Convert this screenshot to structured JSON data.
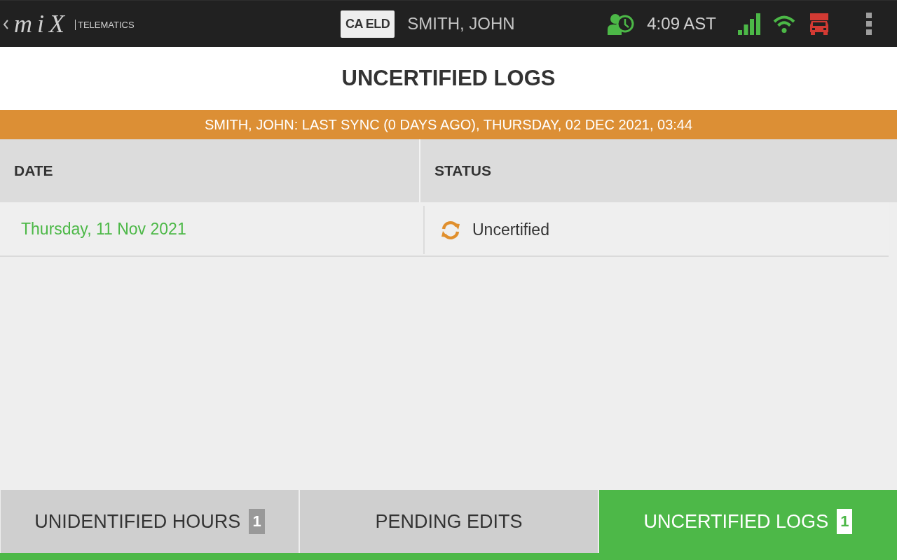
{
  "top_bar": {
    "logo": {
      "wordmark": "miX",
      "tagline": "TELEMATICS"
    },
    "mode_badge": "CA ELD",
    "driver_name": "SMITH, JOHN",
    "time": "4:09 AST"
  },
  "title": "UNCERTIFIED LOGS",
  "sync_banner": "SMITH, JOHN: LAST SYNC (0 DAYS AGO), THURSDAY, 02 DEC 2021, 03:44",
  "table": {
    "columns": [
      "DATE",
      "STATUS"
    ],
    "rows": [
      {
        "date": "Thursday, 11 Nov 2021",
        "status": "Uncertified"
      }
    ]
  },
  "tabs": [
    {
      "label": "UNIDENTIFIED HOURS",
      "count": "1",
      "selected": false
    },
    {
      "label": "PENDING EDITS",
      "selected": false
    },
    {
      "label": "UNCERTIFIED LOGS",
      "count": "1",
      "selected": true
    }
  ]
}
